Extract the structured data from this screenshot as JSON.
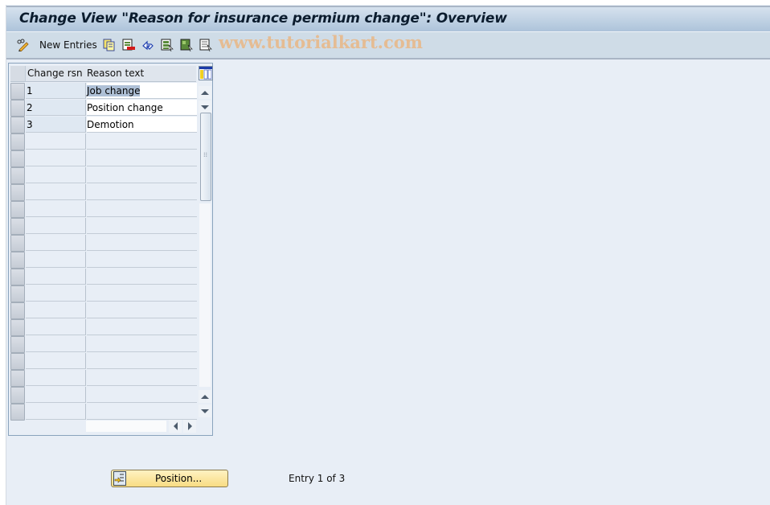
{
  "window": {
    "title": "Change View \"Reason for insurance permium change\": Overview"
  },
  "toolbar": {
    "items": [
      {
        "name": "edit-toggle",
        "icon": "pencil-glasses-icon",
        "label": ""
      },
      {
        "name": "new-entries",
        "icon": "",
        "label": "New Entries"
      },
      {
        "name": "copy-as",
        "icon": "copy-icon",
        "label": ""
      },
      {
        "name": "delete",
        "icon": "delete-row-icon",
        "label": ""
      },
      {
        "name": "undo-change",
        "icon": "undo-icon",
        "label": ""
      },
      {
        "name": "select-all",
        "icon": "select-all-icon",
        "label": ""
      },
      {
        "name": "select-block",
        "icon": "select-block-icon",
        "label": ""
      },
      {
        "name": "deselect-all",
        "icon": "deselect-all-icon",
        "label": ""
      }
    ],
    "watermark": "www.tutorialkart.com"
  },
  "table": {
    "columns": [
      "Change rsn",
      "Reason text"
    ],
    "rows": [
      {
        "code": "1",
        "text": "Job change",
        "selected_text": true
      },
      {
        "code": "2",
        "text": "Position change",
        "selected_text": false
      },
      {
        "code": "3",
        "text": "Demotion",
        "selected_text": false
      }
    ],
    "visible_row_count": 20
  },
  "footer": {
    "position_button": "Position...",
    "entry_info": "Entry 1 of 3"
  },
  "colors": {
    "background": "#e8eef6",
    "title_gradient_top": "#d6e2ee",
    "title_gradient_bottom": "#adc3da",
    "button_yellow": "#f8dc83",
    "watermark": "#e8b98a",
    "selection": "#aec0d6"
  }
}
